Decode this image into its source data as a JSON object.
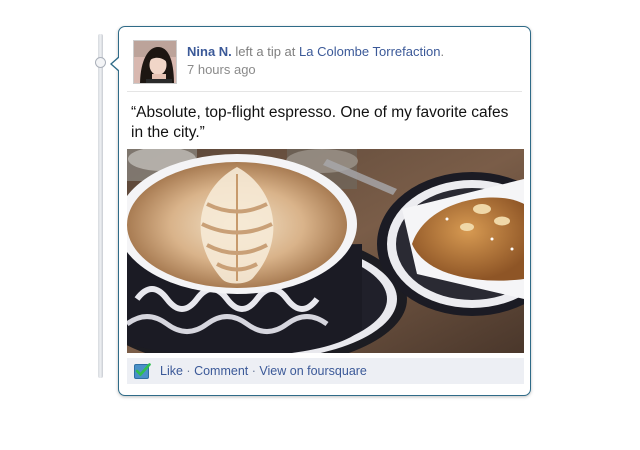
{
  "story": {
    "author": "Nina N.",
    "action": "left a tip at",
    "venue": "La Colombe Torrefaction",
    "period": ".",
    "timestamp": "7 hours ago",
    "tip_text": "“Absolute, top-flight espresso. One of my favorite cafes in the city.”",
    "photo_icon": "photo-latte-art-and-croissant",
    "avatar_icon": "user-avatar"
  },
  "footer": {
    "like_label": "Like",
    "comment_label": "Comment",
    "view_label": "View on foursquare",
    "separator": "·",
    "icon": "checkbox-icon"
  },
  "colors": {
    "link": "#3b5998",
    "card_border": "#2f6b88",
    "footer_bg": "#edeff4"
  }
}
